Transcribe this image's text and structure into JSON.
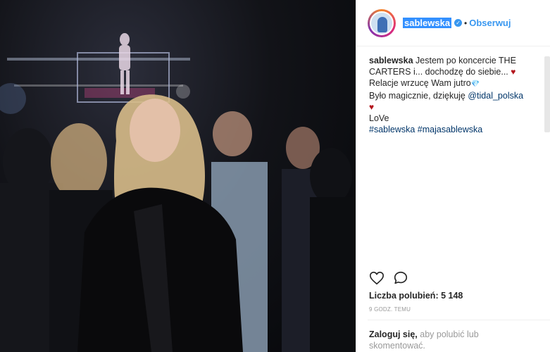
{
  "profile": {
    "username": "sablewska",
    "follow_label": "Obserwuj",
    "dot": "•"
  },
  "caption": {
    "author": "sablewska",
    "line1": "Jestem po koncercie THE CARTERS i... dochodzę do siebie...",
    "line2": "Relacje wrzucę Wam jutro",
    "line3": "Było magicznie, dziękuję",
    "mention": "@tidal_polska",
    "line4": "LoVe",
    "hashtags": "#sablewska #majasablewska",
    "heart_glyph": "♥",
    "diamond_glyph": "💎"
  },
  "stats": {
    "likes_label": "Liczba polubień: 5 148",
    "time_ago": "9 GODZ. TEMU"
  },
  "login": {
    "link": "Zaloguj się,",
    "text": "aby polubić lub skomentować."
  },
  "colors": {
    "accent": "#3897f0",
    "heart": "#b3151c"
  },
  "icons": {
    "like": "heart-outline-icon",
    "comment": "comment-bubble-icon",
    "verified": "verified-badge-icon"
  }
}
